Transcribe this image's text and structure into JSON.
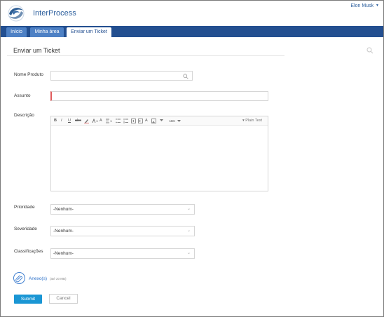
{
  "header": {
    "brand": "InterProcess",
    "user_name": "Elon Musk",
    "user_caret": "▼"
  },
  "nav": {
    "tabs": [
      {
        "label": "Início",
        "active": false
      },
      {
        "label": "Minha área",
        "active": false
      },
      {
        "label": "Enviar um Ticket",
        "active": true
      }
    ]
  },
  "form": {
    "title": "Enviar um Ticket",
    "nome_produto": {
      "label": "Nome Produto",
      "value": ""
    },
    "assunto": {
      "label": "Assunto",
      "value": ""
    },
    "descricao": {
      "label": "Descrição",
      "toolbar": {
        "bold": "B",
        "italic": "I",
        "underline": "U",
        "strike": "abc",
        "font_size": "A",
        "format": "A",
        "spell": "ABC",
        "mode": "▾ Plain Text"
      }
    },
    "prioridade": {
      "label": "Prioridade",
      "value": "-Nenhum-"
    },
    "severidade": {
      "label": "Severidade",
      "value": "-Nenhum-"
    },
    "classificacoes": {
      "label": "Classificações",
      "value": "-Nenhum-"
    },
    "attach": {
      "label": "Anexo(s)",
      "limit": "(até 20 MB)"
    },
    "submit_label": "Submit",
    "cancel_label": "Cancel"
  },
  "colors": {
    "nav_bg": "#234f90",
    "tab_inactive": "#4e81c5",
    "link": "#2a6fc9",
    "submit": "#1a96d4",
    "required": "#e0595a"
  }
}
